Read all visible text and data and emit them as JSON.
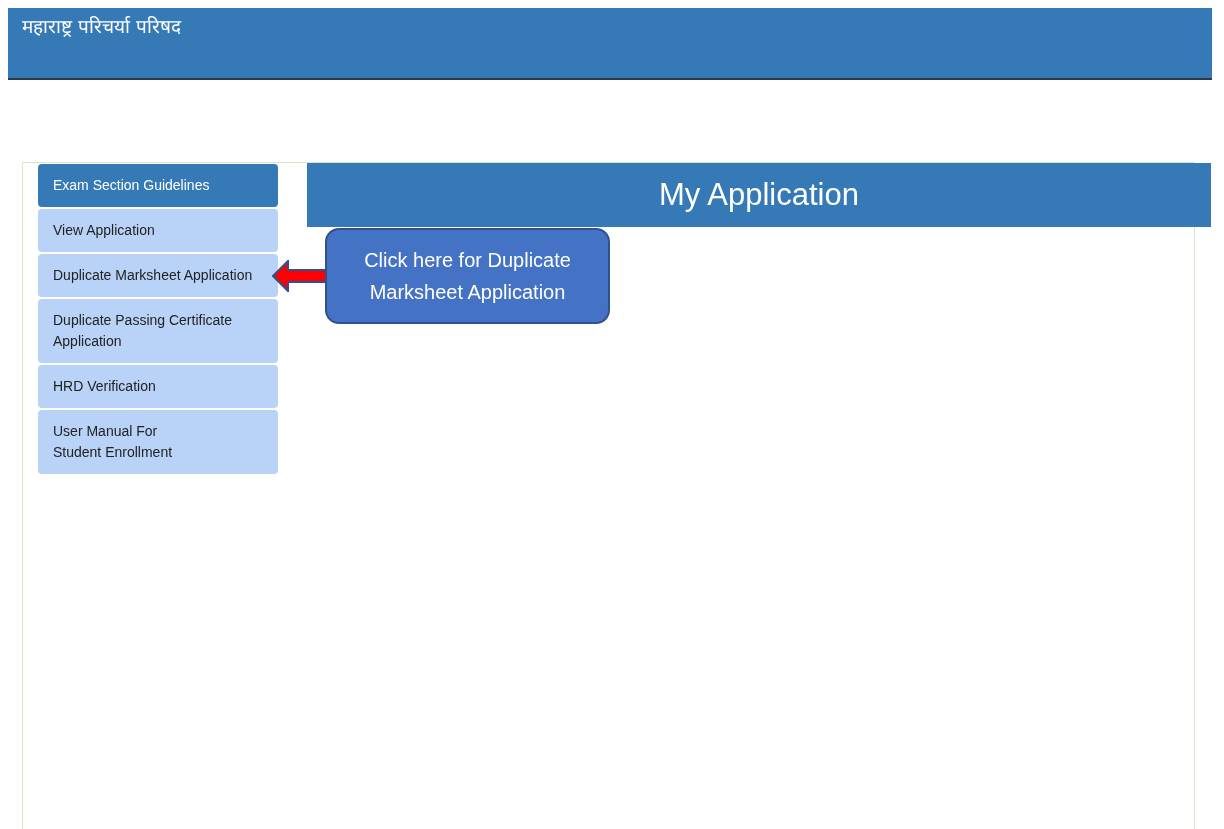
{
  "header": {
    "title": "महाराष्ट्र परिचर्या परिषद"
  },
  "sidebar": {
    "items": [
      {
        "label": "Exam Section Guidelines",
        "selected": true,
        "pointed_at": false
      },
      {
        "label": "View Application",
        "selected": false,
        "pointed_at": false
      },
      {
        "label": "Duplicate Marksheet Application",
        "selected": false,
        "pointed_at": true
      },
      {
        "label": "Duplicate Passing Certificate Application",
        "selected": false,
        "pointed_at": false
      },
      {
        "label": "HRD Verification",
        "selected": false,
        "pointed_at": false
      },
      {
        "label": "User Manual For\nStudent Enrollment",
        "selected": false,
        "pointed_at": false
      }
    ]
  },
  "main": {
    "title": "My Application"
  },
  "callout": {
    "text": "Click here for Duplicate Marksheet Application"
  }
}
